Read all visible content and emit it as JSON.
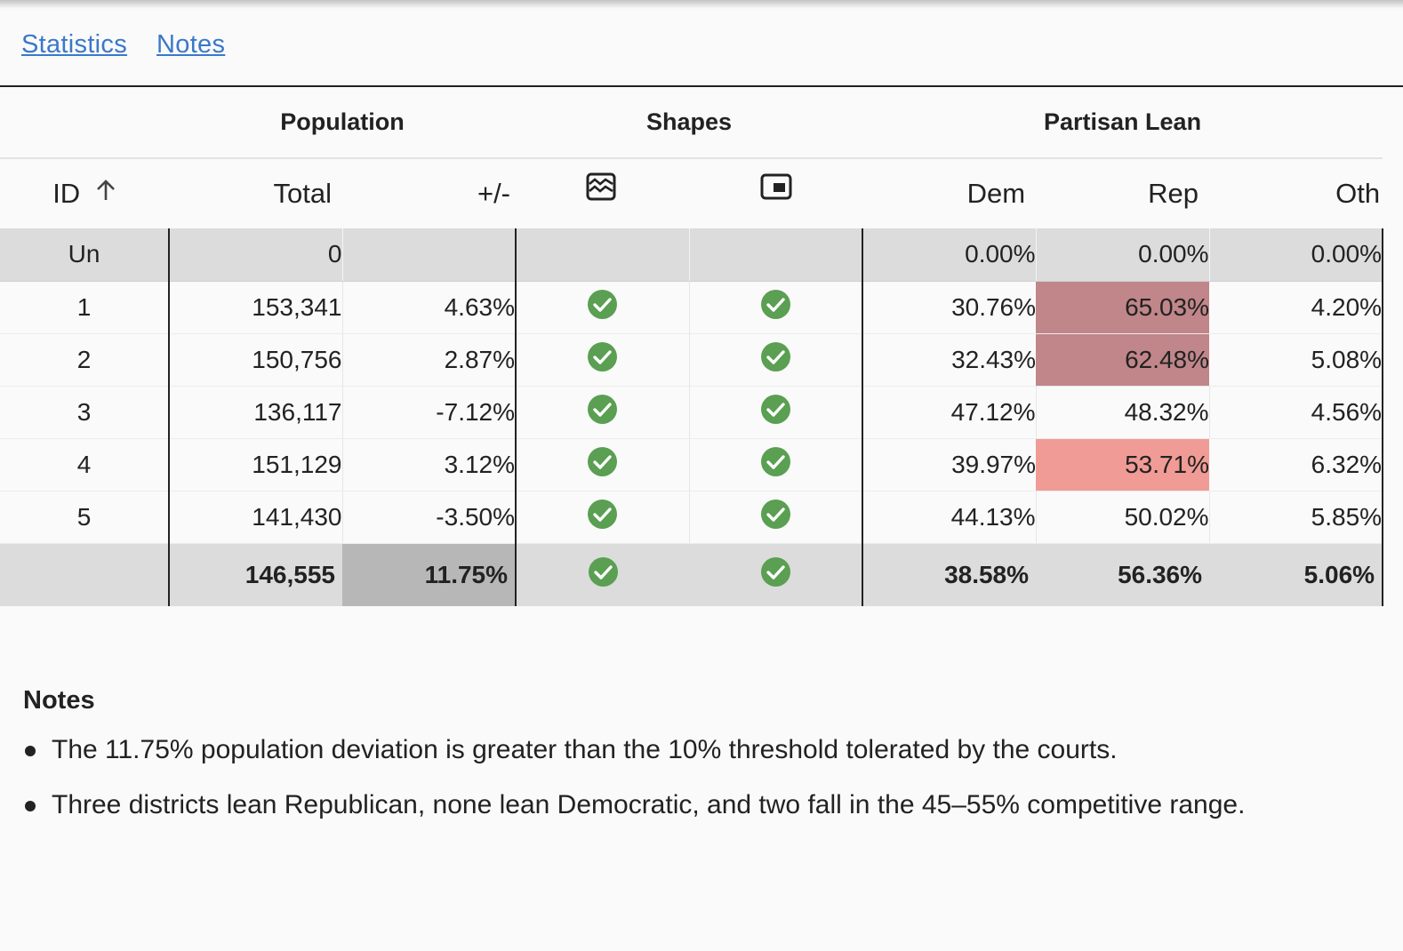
{
  "tabs": [
    {
      "label": "Statistics"
    },
    {
      "label": "Notes"
    }
  ],
  "table": {
    "group_headers": {
      "population": "Population",
      "shapes": "Shapes",
      "partisan_lean": "Partisan Lean"
    },
    "column_headers": {
      "id": "ID",
      "total": "Total",
      "deviation": "+/-",
      "shape_icon_1": "compactness-wave-icon",
      "shape_icon_2": "contiguity-square-icon",
      "dem": "Dem",
      "rep": "Rep",
      "oth": "Oth"
    },
    "sort": {
      "column": "ID",
      "direction": "ascending"
    },
    "unassigned_row": {
      "id": "Un",
      "total": "0",
      "dem": "0.00%",
      "rep": "0.00%",
      "oth": "0.00%"
    },
    "rows": [
      {
        "id": "1",
        "total": "153,341",
        "deviation": "4.63%",
        "shape1": true,
        "shape2": true,
        "dem": "30.76%",
        "rep": "65.03%",
        "oth": "4.20%"
      },
      {
        "id": "2",
        "total": "150,756",
        "deviation": "2.87%",
        "shape1": true,
        "shape2": true,
        "dem": "32.43%",
        "rep": "62.48%",
        "oth": "5.08%"
      },
      {
        "id": "3",
        "total": "136,117",
        "deviation": "-7.12%",
        "shape1": true,
        "shape2": true,
        "dem": "47.12%",
        "rep": "48.32%",
        "oth": "4.56%"
      },
      {
        "id": "4",
        "total": "151,129",
        "deviation": "3.12%",
        "shape1": true,
        "shape2": true,
        "dem": "39.97%",
        "rep": "53.71%",
        "oth": "6.32%"
      },
      {
        "id": "5",
        "total": "141,430",
        "deviation": "-3.50%",
        "shape1": true,
        "shape2": true,
        "dem": "44.13%",
        "rep": "50.02%",
        "oth": "5.85%"
      }
    ],
    "totals_row": {
      "id": "",
      "total": "146,555",
      "deviation": "11.75%",
      "shape1": true,
      "shape2": true,
      "dem": "38.58%",
      "rep": "56.36%",
      "oth": "5.06%"
    }
  },
  "colors": {
    "link": "#3a78c9",
    "check_green": "#5a9f52",
    "rep_strong": "#c0868a",
    "rep_light": "#f09b95",
    "row_gray": "#dcdcdc",
    "deviation_highlight": "#b7b7b7"
  },
  "notes": {
    "title": "Notes",
    "items": [
      "The 11.75% population deviation is greater than the 10% threshold tolerated by the courts.",
      "Three districts lean Republican, none lean Democratic, and two fall in the 45–55% competitive range."
    ]
  }
}
